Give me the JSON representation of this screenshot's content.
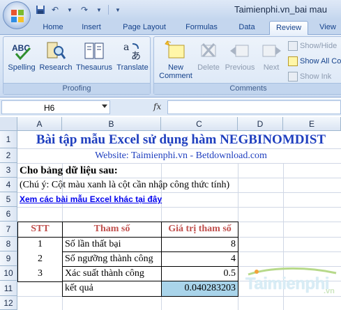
{
  "window": {
    "title": "Taimienphi.vn_bai mau"
  },
  "tabs": [
    "Home",
    "Insert",
    "Page Layout",
    "Formulas",
    "Data",
    "Review",
    "View"
  ],
  "ribbon": {
    "proofing": {
      "label": "Proofing",
      "buttons": [
        "Spelling",
        "Research",
        "Thesaurus",
        "Translate"
      ]
    },
    "comments": {
      "label": "Comments",
      "new_comment": [
        "New",
        "Comment"
      ],
      "delete": "Delete",
      "previous": "Previous",
      "next": "Next",
      "show_hide": "Show/Hide",
      "show_all": "Show All Co",
      "show_ink": "Show Ink"
    }
  },
  "formula_bar": {
    "name_box": "H6",
    "fx": "fx",
    "content": ""
  },
  "columns": [
    "A",
    "B",
    "C",
    "D",
    "E"
  ],
  "rows": [
    "1",
    "2",
    "3",
    "4",
    "5",
    "6",
    "7",
    "8",
    "9",
    "10",
    "11",
    "12"
  ],
  "sheet": {
    "title": "Bài tập mẫu Excel sử dụng hàm NEGBINOMDIST",
    "website": "Website: Taimienphi.vn - Betdownload.com",
    "given": "Cho bảng dữ liệu sau:",
    "note": "(Chú ý: Cột màu xanh là cột cần nhập công thức tính)",
    "link": "Xem các bài mẫu Excel khác tại đây",
    "headers": [
      "STT",
      "Tham số",
      "Giá trị tham số"
    ],
    "table": [
      {
        "stt": "1",
        "param": "Số lần thất bại",
        "value": "8"
      },
      {
        "stt": "2",
        "param": "Số ngưỡng thành công",
        "value": "4"
      },
      {
        "stt": "3",
        "param": "Xác suất thành công",
        "value": "0.5"
      }
    ],
    "result_label": "kết quả",
    "result_value": "0.040283203"
  },
  "watermark": {
    "brand": "Taimienphi",
    "suffix": ".vn"
  },
  "colors": {
    "header_text": "#c0504d",
    "title_blue": "#1f3fbf",
    "result_fill": "#a9d4ea",
    "ribbon_bg": "#dbe7f6"
  }
}
